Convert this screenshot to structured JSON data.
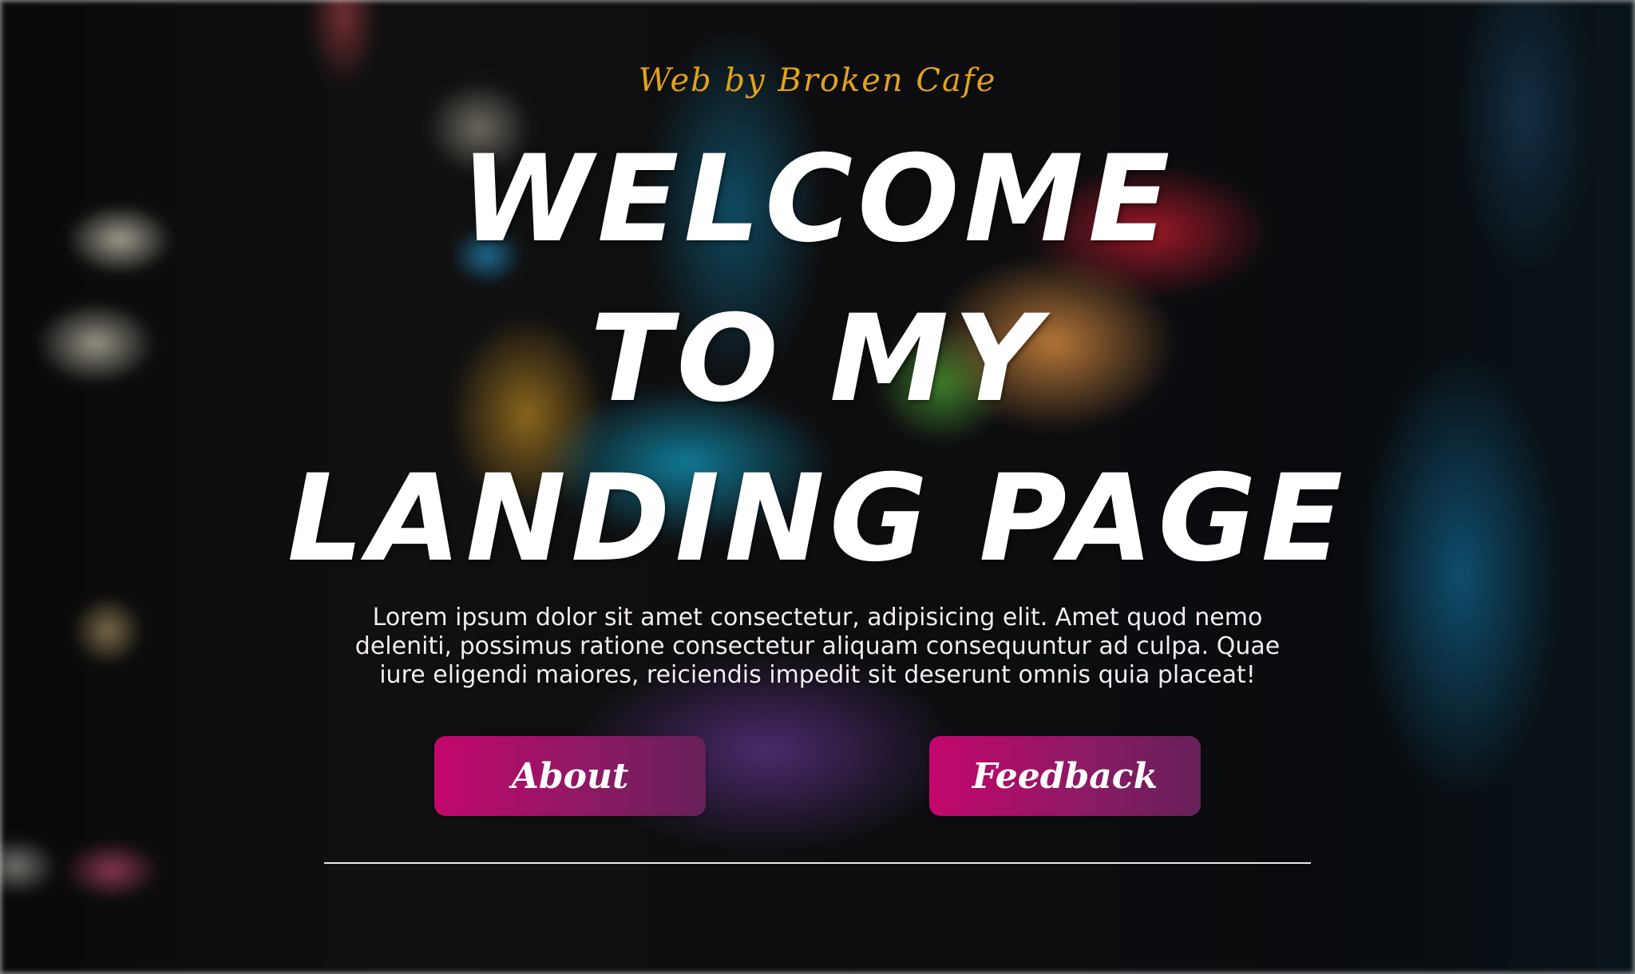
{
  "brand": {
    "name": "Web by Broken Cafe"
  },
  "hero": {
    "headline_lines": [
      "Welcome",
      "to my",
      "landing page"
    ],
    "description": "Lorem ipsum dolor sit amet consectetur, adipisicing elit. Amet quod nemo deleniti, possimus ratione consectetur aliquam consequuntur ad culpa. Quae iure eligendi maiores, reiciendis impedit sit deserunt omnis quia placeat!"
  },
  "buttons": {
    "about_label": "About",
    "feedback_label": "Feedback"
  },
  "colors": {
    "brand_text": "#e0a21f",
    "button_gradient_start": "#c4066e",
    "button_gradient_end": "#662058",
    "headline": "#ffffff"
  }
}
